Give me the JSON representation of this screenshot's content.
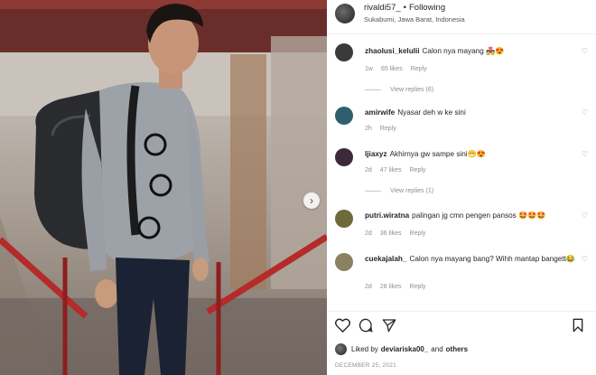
{
  "post": {
    "username": "rivaldi57_",
    "separator": "•",
    "follow_label": "Following",
    "location": "Sukabumi, Jawa Barat, Indonesia"
  },
  "comments": [
    {
      "username": "zhaolusi_kelulii",
      "text": "Calon nya mayang 💑😍",
      "time": "1w",
      "likes": "65 likes",
      "reply": "Reply",
      "view_replies": "View replies (6)",
      "avatar_color": "#3a3a3a"
    },
    {
      "username": "amirwife",
      "text": "Nyasar deh w ke sini",
      "time": "2h",
      "likes": "",
      "reply": "Reply",
      "view_replies": "",
      "avatar_color": "#2f5f6f"
    },
    {
      "username": "ljiaxyz",
      "text": "Akhirnya gw sampe sini😁😍",
      "time": "2d",
      "likes": "47 likes",
      "reply": "Reply",
      "view_replies": "View replies (1)",
      "avatar_color": "#3b2a3a"
    },
    {
      "username": "putri.wiratna",
      "text": "palingan jg cmn pengen pansos 🤩🤩🤩",
      "time": "2d",
      "likes": "36 likes",
      "reply": "Reply",
      "view_replies": "",
      "avatar_color": "#6e6a3a"
    },
    {
      "username": "cuekajalah_",
      "text": "Calon nya mayang bang? Wihh mantap bangett😂",
      "time": "2d",
      "likes": "28 likes",
      "reply": "Reply",
      "view_replies": "",
      "avatar_color": "#8a8160"
    }
  ],
  "footer": {
    "liked_prefix": "Liked by",
    "liked_user": "deviariska00_",
    "liked_and": "and",
    "liked_others": "others",
    "date": "DECEMBER 25, 2021"
  },
  "icons": [
    "heart-icon",
    "comment-icon",
    "share-icon",
    "bookmark-icon",
    "chevron-right-icon"
  ]
}
